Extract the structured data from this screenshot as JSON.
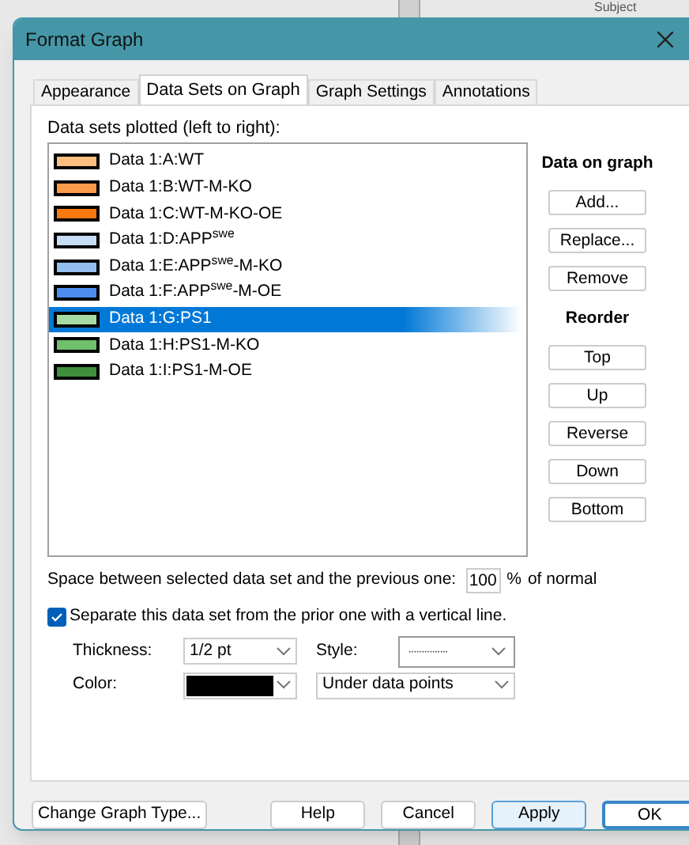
{
  "background": {
    "texts": [
      "Subject"
    ]
  },
  "window": {
    "title": "Format Graph"
  },
  "tabs": [
    {
      "label": "Appearance",
      "selected": false
    },
    {
      "label": "Data Sets on Graph",
      "selected": true
    },
    {
      "label": "Graph Settings",
      "selected": false
    },
    {
      "label": "Annotations",
      "selected": false
    }
  ],
  "list_label": "Data sets plotted (left to right):",
  "data_sets": [
    {
      "label": "Data 1:A:WT",
      "color": "#fdbf80",
      "selected": false
    },
    {
      "label": "Data 1:B:WT-M-KO",
      "color": "#fb9a4a",
      "selected": false
    },
    {
      "label": "Data 1:C:WT-M-KO-OE",
      "color": "#f7790f",
      "selected": false
    },
    {
      "label": "Data 1:D:APP$^{swe}$",
      "color": "#c7dcf5",
      "selected": false
    },
    {
      "label": "Data 1:E:APP$^{swe}$-M-KO",
      "color": "#94bdf0",
      "selected": false
    },
    {
      "label": "Data 1:F:APP$^{swe}$-M-OE",
      "color": "#4b8ef0",
      "selected": false
    },
    {
      "label": "Data 1:G:PS1",
      "color": "#a7dba3",
      "selected": true
    },
    {
      "label": "Data 1:H:PS1-M-KO",
      "color": "#6fc06c",
      "selected": false
    },
    {
      "label": "Data 1:I:PS1-M-OE",
      "color": "#3f8f3c",
      "selected": false
    }
  ],
  "side_groups": [
    {
      "heading": "Data on graph",
      "buttons": [
        "Add...",
        "Replace...",
        "Remove"
      ]
    },
    {
      "heading": "Reorder",
      "buttons": [
        "Top",
        "Up",
        "Reverse",
        "Down",
        "Bottom"
      ]
    }
  ],
  "spacing": {
    "label": "Space between selected data set and the previous one:",
    "value": "100",
    "unit": "%",
    "suffix": "of normal"
  },
  "separate": {
    "label": "Separate this data set from the prior one with a vertical line.",
    "checked": true
  },
  "thickness": {
    "label": "Thickness:",
    "value": "1/2 pt"
  },
  "style": {
    "label": "Style:",
    "value": "···············"
  },
  "line_color": {
    "label": "Color:",
    "color": "#000000"
  },
  "position": {
    "value": "Under data points"
  },
  "footer": {
    "left": "Change Graph Type...",
    "buttons": [
      {
        "label": "Help",
        "highlighted": false,
        "default": false
      },
      {
        "label": "Cancel",
        "highlighted": false,
        "default": false
      },
      {
        "label": "Apply",
        "highlighted": true,
        "default": false
      },
      {
        "label": "OK",
        "highlighted": false,
        "default": true
      }
    ]
  }
}
